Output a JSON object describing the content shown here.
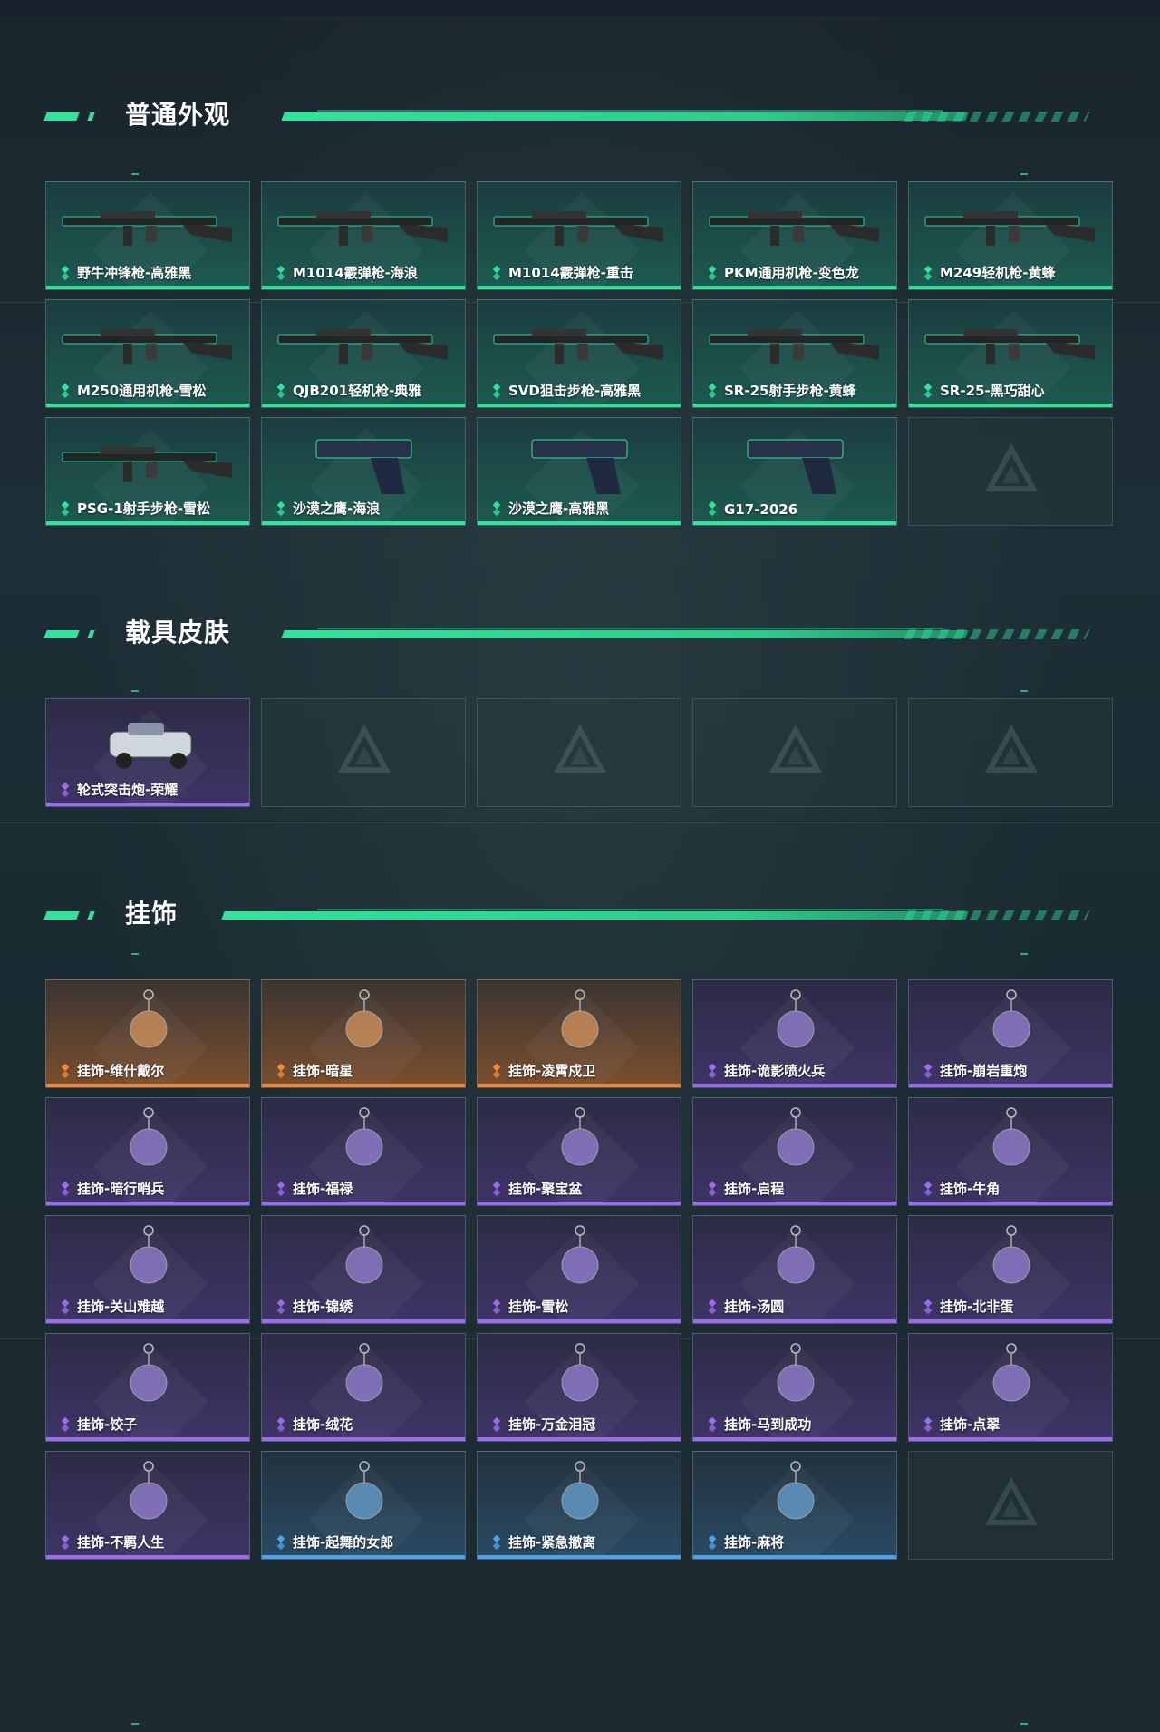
{
  "sections": {
    "weapons": {
      "title": "普通外观",
      "items": [
        {
          "label": "野牛冲锋枪-高雅黑",
          "rarity": "green",
          "icon": "smg-icon"
        },
        {
          "label": "M1014霰弹枪-海浪",
          "rarity": "green",
          "icon": "shotgun-icon"
        },
        {
          "label": "M1014霰弹枪-重击",
          "rarity": "green",
          "icon": "shotgun-icon"
        },
        {
          "label": "PKM通用机枪-变色龙",
          "rarity": "green",
          "icon": "machine-gun-icon"
        },
        {
          "label": "M249轻机枪-黄蜂",
          "rarity": "green",
          "icon": "machine-gun-icon"
        },
        {
          "label": "M250通用机枪-雪松",
          "rarity": "green",
          "icon": "machine-gun-icon"
        },
        {
          "label": "QJB201轻机枪-典雅",
          "rarity": "green",
          "icon": "machine-gun-icon"
        },
        {
          "label": "SVD狙击步枪-高雅黑",
          "rarity": "green",
          "icon": "sniper-rifle-icon"
        },
        {
          "label": "SR-25射手步枪-黄蜂",
          "rarity": "green",
          "icon": "rifle-icon"
        },
        {
          "label": "SR-25-黑巧甜心",
          "rarity": "green",
          "icon": "rifle-icon"
        },
        {
          "label": "PSG-1射手步枪-雪松",
          "rarity": "green",
          "icon": "sniper-rifle-icon"
        },
        {
          "label": "沙漠之鹰-海浪",
          "rarity": "green",
          "icon": "pistol-icon"
        },
        {
          "label": "沙漠之鹰-高雅黑",
          "rarity": "green",
          "icon": "pistol-icon"
        },
        {
          "label": "G17-2026",
          "rarity": "green",
          "icon": "pistol-icon"
        },
        {
          "label": "",
          "rarity": "empty",
          "icon": "empty-slot-icon"
        }
      ]
    },
    "vehicles": {
      "title": "载具皮肤",
      "items": [
        {
          "label": "轮式突击炮-荣耀",
          "rarity": "purple",
          "icon": "vehicle-icon"
        },
        {
          "label": "",
          "rarity": "empty",
          "icon": "empty-slot-icon"
        },
        {
          "label": "",
          "rarity": "empty",
          "icon": "empty-slot-icon"
        },
        {
          "label": "",
          "rarity": "empty",
          "icon": "empty-slot-icon"
        },
        {
          "label": "",
          "rarity": "empty",
          "icon": "empty-slot-icon"
        }
      ]
    },
    "charms": {
      "title": "挂饰",
      "items": [
        {
          "label": "挂饰-维什戴尔",
          "rarity": "orange",
          "icon": "charm-icon"
        },
        {
          "label": "挂饰-暗星",
          "rarity": "orange",
          "icon": "charm-icon"
        },
        {
          "label": "挂饰-凌霄戍卫",
          "rarity": "orange",
          "icon": "charm-icon"
        },
        {
          "label": "挂饰-诡影喷火兵",
          "rarity": "purple",
          "icon": "charm-icon"
        },
        {
          "label": "挂饰-崩岩重炮",
          "rarity": "purple",
          "icon": "charm-icon"
        },
        {
          "label": "挂饰-暗行哨兵",
          "rarity": "purple",
          "icon": "charm-icon"
        },
        {
          "label": "挂饰-福禄",
          "rarity": "purple",
          "icon": "charm-icon"
        },
        {
          "label": "挂饰-聚宝盆",
          "rarity": "purple",
          "icon": "charm-icon"
        },
        {
          "label": "挂饰-启程",
          "rarity": "purple",
          "icon": "charm-icon"
        },
        {
          "label": "挂饰-牛角",
          "rarity": "purple",
          "icon": "charm-icon"
        },
        {
          "label": "挂饰-关山难越",
          "rarity": "purple",
          "icon": "charm-icon"
        },
        {
          "label": "挂饰-锦绣",
          "rarity": "purple",
          "icon": "charm-icon"
        },
        {
          "label": "挂饰-雪松",
          "rarity": "purple",
          "icon": "charm-icon"
        },
        {
          "label": "挂饰-汤圆",
          "rarity": "purple",
          "icon": "charm-icon"
        },
        {
          "label": "挂饰-北非蛋",
          "rarity": "purple",
          "icon": "charm-icon"
        },
        {
          "label": "挂饰-饺子",
          "rarity": "purple",
          "icon": "charm-icon"
        },
        {
          "label": "挂饰-绒花",
          "rarity": "purple",
          "icon": "charm-icon"
        },
        {
          "label": "挂饰-万金泪冠",
          "rarity": "purple",
          "icon": "charm-icon"
        },
        {
          "label": "挂饰-马到成功",
          "rarity": "purple",
          "icon": "charm-icon"
        },
        {
          "label": "挂饰-点翠",
          "rarity": "purple",
          "icon": "charm-icon"
        },
        {
          "label": "挂饰-不羁人生",
          "rarity": "purple",
          "icon": "charm-icon"
        },
        {
          "label": "挂饰-起舞的女郎",
          "rarity": "blue",
          "icon": "charm-icon"
        },
        {
          "label": "挂饰-紧急撤离",
          "rarity": "blue",
          "icon": "charm-icon"
        },
        {
          "label": "挂饰-麻将",
          "rarity": "blue",
          "icon": "charm-icon"
        },
        {
          "label": "",
          "rarity": "empty",
          "icon": "empty-slot-icon"
        }
      ]
    }
  },
  "colors": {
    "accent": "#2ee59a",
    "green": "#2ee59a",
    "purple": "#9b6cf0",
    "orange": "#f08a3a",
    "blue": "#4aa3f0"
  }
}
